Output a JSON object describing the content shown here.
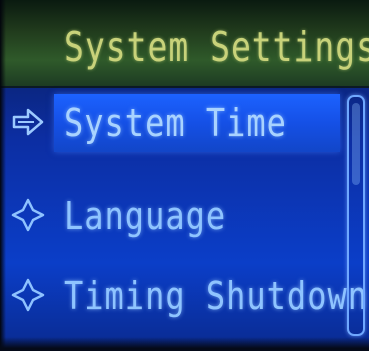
{
  "header": {
    "title": "System Settings"
  },
  "menu": {
    "items": [
      {
        "label": "System Time",
        "marker": "arrow-right-icon",
        "selected": true
      },
      {
        "label": "Language",
        "marker": "diamond-icon",
        "selected": false
      },
      {
        "label": "Timing Shutdown",
        "marker": "diamond-icon",
        "selected": false
      }
    ]
  },
  "colors": {
    "header_bg": "#2f5a2a",
    "header_text": "#c8d27a",
    "screen_bg": "#0c2ea3",
    "highlight": "#1c62ff",
    "item_text": "#8fc4ff"
  }
}
